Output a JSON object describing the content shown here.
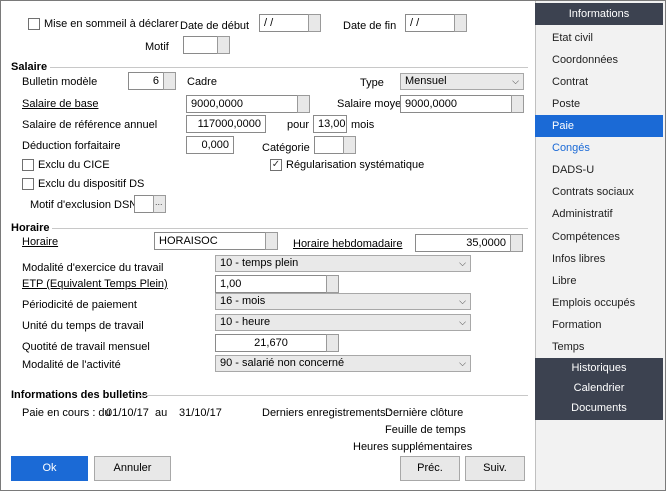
{
  "top": {
    "sommeil_label": "Mise en sommeil à déclarer",
    "date_debut_label": "Date de début",
    "date_debut_value": " / /",
    "date_fin_label": "Date de fin",
    "date_fin_value": " / /",
    "motif_label": "Motif"
  },
  "salaire": {
    "section_title": "Salaire",
    "bulletin_modele_label": "Bulletin modèle",
    "bulletin_modele_value": "6",
    "bulletin_modele_name": "Cadre",
    "type_label": "Type",
    "type_value": "Mensuel",
    "salaire_base_label": "Salaire de base",
    "salaire_base_value": "9000,0000",
    "salaire_moyen_label": "Salaire moyen",
    "salaire_moyen_value": "9000,0000",
    "salaire_ref_label": "Salaire de référence annuel",
    "salaire_ref_value": "117000,0000",
    "pour_label": "pour",
    "mois_value": "13,00",
    "mois_label": "mois",
    "deduction_label": "Déduction forfaitaire",
    "deduction_value": "0,000",
    "categorie_label": "Catégorie",
    "exclu_cice_label": "Exclu du CICE",
    "regularisation_label": "Régularisation systématique",
    "exclu_ds_label": "Exclu du dispositif DS",
    "motif_dsn_label": "Motif d'exclusion DSN"
  },
  "horaire": {
    "section_title": "Horaire",
    "horaire_label": "Horaire",
    "horaire_value": "HORAISOC",
    "hebdo_label": "Horaire hebdomadaire",
    "hebdo_value": "35,0000",
    "modalite_exercice_label": "Modalité d'exercice du travail",
    "modalite_exercice_value": "10 - temps plein",
    "etp_label": "ETP (Equivalent Temps Plein)",
    "etp_value": "1,00",
    "periodicite_label": "Périodicité de paiement",
    "periodicite_value": "16 - mois",
    "unite_label": "Unité du temps de travail",
    "unite_value": "10 - heure",
    "quotite_label": "Quotité de travail mensuel",
    "quotite_value": "21,670",
    "modalite_activite_label": "Modalité de l'activité",
    "modalite_activite_value": "90 - salarié non concerné"
  },
  "bulletins": {
    "section_title": "Informations des bulletins",
    "paie_label": "Paie en cours : du",
    "paie_du": "01/10/17",
    "au_label": "au",
    "paie_au": "31/10/17",
    "derniers_label": "Derniers enregistrements :",
    "derniere_cloture": "Dernière clôture",
    "feuille_temps": "Feuille de temps",
    "heures_sup": "Heures supplémentaires"
  },
  "buttons": {
    "ok": "Ok",
    "annuler": "Annuler",
    "prec": "Préc.",
    "suiv": "Suiv."
  },
  "sidebar": {
    "header": "Informations",
    "items": [
      "Etat civil",
      "Coordonnées",
      "Contrat",
      "Poste",
      "Paie",
      "Congés",
      "DADS-U",
      "Contrats sociaux",
      "Administratif",
      "Compétences",
      "Infos libres",
      "Libre",
      "Emplois occupés",
      "Formation",
      "Temps"
    ],
    "active_item": "Paie",
    "sub_items": [
      "Historiques",
      "Calendrier",
      "Documents"
    ]
  },
  "colors": {
    "accent": "#1b6ad6",
    "dark_panel": "#3c4250",
    "link_conges": "#1b6ad6"
  }
}
